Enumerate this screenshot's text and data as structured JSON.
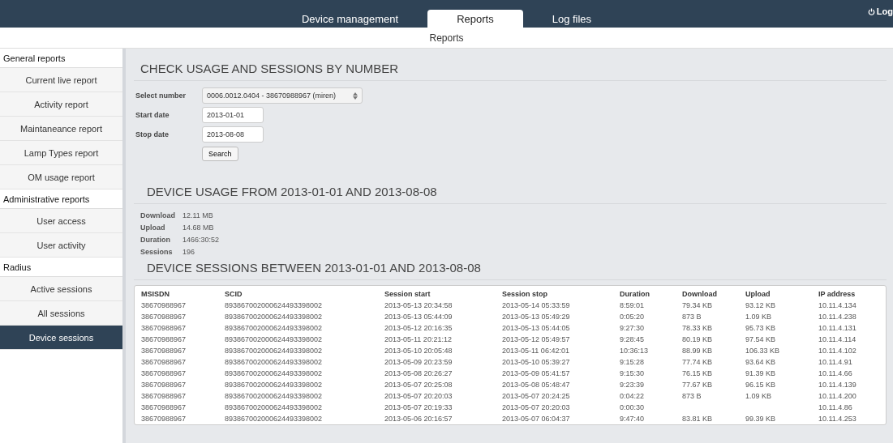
{
  "top_nav": {
    "tabs": [
      {
        "label": "Device management",
        "selected": false
      },
      {
        "label": "Reports",
        "selected": true
      },
      {
        "label": "Log files",
        "selected": false
      }
    ],
    "logout": "Log"
  },
  "sub_nav": {
    "title": "Reports"
  },
  "sidebar": {
    "sections": [
      {
        "title": "General reports",
        "items": [
          {
            "label": "Current live report",
            "selected": false
          },
          {
            "label": "Activity report",
            "selected": false
          },
          {
            "label": "Maintaneance report",
            "selected": false
          },
          {
            "label": "Lamp Types report",
            "selected": false
          },
          {
            "label": "OM usage report",
            "selected": false
          }
        ]
      },
      {
        "title": "Administrative reports",
        "items": [
          {
            "label": "User access",
            "selected": false
          },
          {
            "label": "User activity",
            "selected": false
          }
        ]
      },
      {
        "title": "Radius",
        "items": [
          {
            "label": "Active sessions",
            "selected": false
          },
          {
            "label": "All sessions",
            "selected": false
          },
          {
            "label": "Device sessions",
            "selected": true
          }
        ]
      }
    ]
  },
  "form": {
    "title": "CHECK USAGE AND SESSIONS BY NUMBER",
    "select_label": "Select number",
    "select_value": "0006.0012.0404 - 38670988967 (miren)",
    "start_label": "Start date",
    "start_value": "2013-01-01",
    "stop_label": "Stop date",
    "stop_value": "2013-08-08",
    "button": "Search"
  },
  "usage": {
    "title": "DEVICE USAGE FROM 2013-01-01 AND 2013-08-08",
    "stats": [
      {
        "label": "Download",
        "value": "12.11 MB"
      },
      {
        "label": "Upload",
        "value": "14.68 MB"
      },
      {
        "label": "Duration",
        "value": "1466:30:52"
      },
      {
        "label": "Sessions",
        "value": "196"
      }
    ]
  },
  "sessions": {
    "title": "DEVICE SESSIONS BETWEEN 2013-01-01 AND 2013-08-08",
    "columns": [
      "MSISDN",
      "SCID",
      "Session start",
      "Session stop",
      "Duration",
      "Download",
      "Upload",
      "IP address"
    ],
    "rows": [
      [
        "38670988967",
        "893867002000624493398002",
        "2013-05-13 20:34:58",
        "2013-05-14 05:33:59",
        "8:59:01",
        "79.34 KB",
        "93.12 KB",
        "10.11.4.134"
      ],
      [
        "38670988967",
        "893867002000624493398002",
        "2013-05-13 05:44:09",
        "2013-05-13 05:49:29",
        "0:05:20",
        "873 B",
        "1.09 KB",
        "10.11.4.238"
      ],
      [
        "38670988967",
        "893867002000624493398002",
        "2013-05-12 20:16:35",
        "2013-05-13 05:44:05",
        "9:27:30",
        "78.33 KB",
        "95.73 KB",
        "10.11.4.131"
      ],
      [
        "38670988967",
        "893867002000624493398002",
        "2013-05-11 20:21:12",
        "2013-05-12 05:49:57",
        "9:28:45",
        "80.19 KB",
        "97.54 KB",
        "10.11.4.114"
      ],
      [
        "38670988967",
        "893867002000624493398002",
        "2013-05-10 20:05:48",
        "2013-05-11 06:42:01",
        "10:36:13",
        "88.99 KB",
        "106.33 KB",
        "10.11.4.102"
      ],
      [
        "38670988967",
        "893867002000624493398002",
        "2013-05-09 20:23:59",
        "2013-05-10 05:39:27",
        "9:15:28",
        "77.74 KB",
        "93.64 KB",
        "10.11.4.91"
      ],
      [
        "38670988967",
        "893867002000624493398002",
        "2013-05-08 20:26:27",
        "2013-05-09 05:41:57",
        "9:15:30",
        "76.15 KB",
        "91.39 KB",
        "10.11.4.66"
      ],
      [
        "38670988967",
        "893867002000624493398002",
        "2013-05-07 20:25:08",
        "2013-05-08 05:48:47",
        "9:23:39",
        "77.67 KB",
        "96.15 KB",
        "10.11.4.139"
      ],
      [
        "38670988967",
        "893867002000624493398002",
        "2013-05-07 20:20:03",
        "2013-05-07 20:24:25",
        "0:04:22",
        "873 B",
        "1.09 KB",
        "10.11.4.200"
      ],
      [
        "38670988967",
        "893867002000624493398002",
        "2013-05-07 20:19:33",
        "2013-05-07 20:20:03",
        "0:00:30",
        "",
        "",
        "10.11.4.86"
      ],
      [
        "38670988967",
        "893867002000624493398002",
        "2013-05-06 20:16:57",
        "2013-05-07 06:04:37",
        "9:47:40",
        "83.81 KB",
        "99.39 KB",
        "10.11.4.253"
      ]
    ]
  }
}
